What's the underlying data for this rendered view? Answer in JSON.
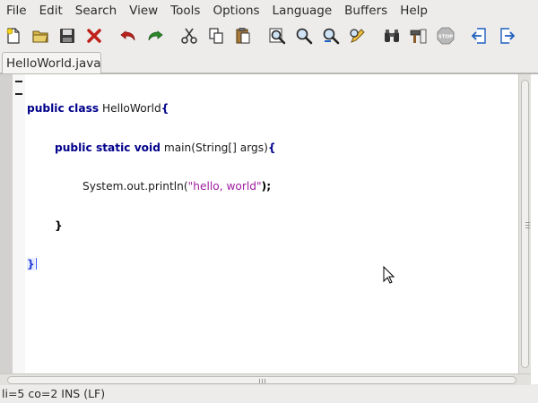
{
  "menu": {
    "items": [
      "File",
      "Edit",
      "Search",
      "View",
      "Tools",
      "Options",
      "Language",
      "Buffers",
      "Help"
    ]
  },
  "toolbar": {
    "buttons": [
      {
        "icon": "new-file-icon"
      },
      {
        "icon": "open-folder-icon"
      },
      {
        "icon": "save-icon"
      },
      {
        "icon": "close-icon"
      },
      {
        "icon": "undo-icon"
      },
      {
        "icon": "redo-icon"
      },
      {
        "icon": "cut-icon"
      },
      {
        "icon": "copy-icon"
      },
      {
        "icon": "paste-icon"
      },
      {
        "icon": "find-icon"
      },
      {
        "icon": "find-next-icon"
      },
      {
        "icon": "find-replace-icon"
      },
      {
        "icon": "edit-pencil-icon"
      },
      {
        "icon": "binoculars-icon"
      },
      {
        "icon": "build-icon"
      },
      {
        "icon": "stop-icon"
      },
      {
        "icon": "previous-buffer-icon"
      },
      {
        "icon": "next-buffer-icon"
      }
    ],
    "stop_label": "STOP"
  },
  "tab": {
    "label": "HelloWorld.java"
  },
  "code": {
    "line1_kw": "public class",
    "line1_name": " HelloWorld",
    "line1_brace": "{",
    "line2_indent": "        ",
    "line2_kw": "public static void",
    "line2_rest": " main(String[] args)",
    "line2_brace": "{",
    "line3_indent": "                ",
    "line3_call": "System.out.println(",
    "line3_str": "\"hello, world\"",
    "line3_end": ");",
    "line4_indent": "        ",
    "line4_brace": "}",
    "line5_brace": "}"
  },
  "status": {
    "text": "li=5 co=2 INS (LF)"
  },
  "colors": {
    "keyword": "#00008b",
    "string": "#a020a0",
    "undo_red": "#c0201a",
    "redo_green": "#2a8a2a"
  }
}
